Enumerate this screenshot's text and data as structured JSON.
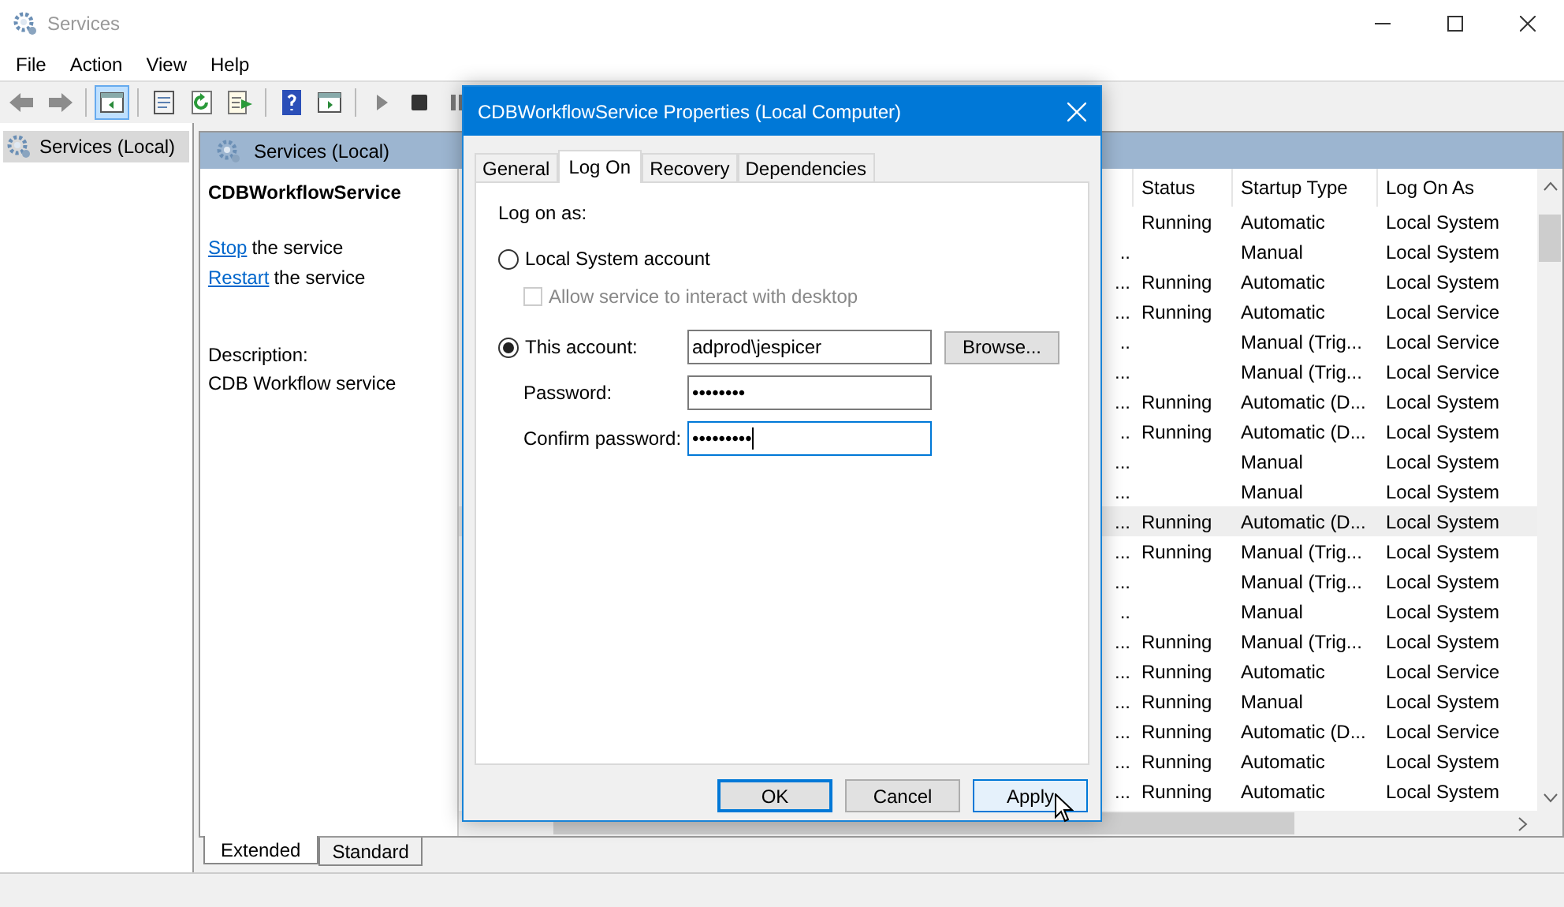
{
  "window": {
    "title": "Services"
  },
  "menu": [
    "File",
    "Action",
    "View",
    "Help"
  ],
  "toolbar": [
    [
      {
        "kind": "back",
        "pressed": false
      },
      {
        "kind": "forward",
        "pressed": false
      }
    ],
    [
      {
        "kind": "tree",
        "pressed": true
      }
    ],
    [
      {
        "kind": "properties",
        "pressed": false
      },
      {
        "kind": "refresh",
        "pressed": false
      },
      {
        "kind": "export",
        "pressed": false
      }
    ],
    [
      {
        "kind": "help",
        "pressed": false
      },
      {
        "kind": "panel",
        "pressed": false
      }
    ],
    [
      {
        "kind": "play",
        "pressed": false
      },
      {
        "kind": "stop",
        "pressed": false
      },
      {
        "kind": "pause",
        "pressed": false
      }
    ]
  ],
  "tree": {
    "items": [
      {
        "label": "Services (Local)",
        "selected": true
      }
    ]
  },
  "pane": {
    "header": "Services (Local)",
    "service_name": "CDBWorkflowService",
    "actions": [
      {
        "link": "Stop",
        "text": "the service"
      },
      {
        "link": "Restart",
        "text": "the service"
      }
    ],
    "description_label": "Description:",
    "description": "CDB Workflow service"
  },
  "table": {
    "columns": [
      "Status",
      "Startup Type",
      "Log On As"
    ],
    "rows": [
      {
        "column_1": "",
        "status": "Running",
        "startup": "Automatic",
        "logon": "Local System",
        "selected": false
      },
      {
        "column_1": "..",
        "startup": "Manual",
        "logon": "Local System",
        "selected": false
      },
      {
        "column_1": "...",
        "status": "Running",
        "startup": "Automatic",
        "logon": "Local System",
        "selected": false
      },
      {
        "column_1": "...",
        "status": "Running",
        "startup": "Automatic",
        "logon": "Local Service",
        "selected": false
      },
      {
        "column_1": "..",
        "startup": "Manual (Trig...",
        "logon": "Local Service",
        "selected": false
      },
      {
        "column_1": "...",
        "startup": "Manual (Trig...",
        "logon": "Local Service",
        "selected": false
      },
      {
        "column_1": "...",
        "status": "Running",
        "startup": "Automatic (D...",
        "logon": "Local System",
        "selected": false
      },
      {
        "column_1": "..",
        "status": "Running",
        "startup": "Automatic (D...",
        "logon": "Local System",
        "selected": false
      },
      {
        "column_1": "...",
        "startup": "Manual",
        "logon": "Local System",
        "selected": false
      },
      {
        "column_1": "...",
        "startup": "Manual",
        "logon": "Local System",
        "selected": false
      },
      {
        "column_1": "...",
        "status": "Running",
        "startup": "Automatic (D...",
        "logon": "Local System",
        "selected": true
      },
      {
        "column_1": "...",
        "status": "Running",
        "startup": "Manual (Trig...",
        "logon": "Local System",
        "selected": false
      },
      {
        "column_1": "...",
        "startup": "Manual (Trig...",
        "logon": "Local System",
        "selected": false
      },
      {
        "column_1": "..",
        "startup": "Manual",
        "logon": "Local System",
        "selected": false
      },
      {
        "column_1": "...",
        "status": "Running",
        "startup": "Manual (Trig...",
        "logon": "Local System",
        "selected": false
      },
      {
        "column_1": "...",
        "status": "Running",
        "startup": "Automatic",
        "logon": "Local Service",
        "selected": false
      },
      {
        "column_1": "...",
        "status": "Running",
        "startup": "Manual",
        "logon": "Local System",
        "selected": false
      },
      {
        "column_1": "...",
        "status": "Running",
        "startup": "Automatic (D...",
        "logon": "Local Service",
        "selected": false
      },
      {
        "column_1": "...",
        "status": "Running",
        "startup": "Automatic",
        "logon": "Local System",
        "selected": false
      },
      {
        "column_1": "...",
        "status": "Running",
        "startup": "Automatic",
        "logon": "Local System",
        "selected": false
      }
    ]
  },
  "view_tabs": [
    {
      "label": "Extended",
      "selected": true
    },
    {
      "label": "Standard",
      "selected": false
    }
  ],
  "dialog": {
    "title": "CDBWorkflowService Properties (Local Computer)",
    "tabs": [
      {
        "label": "General",
        "selected": false
      },
      {
        "label": "Log On",
        "selected": true
      },
      {
        "label": "Recovery",
        "selected": false
      },
      {
        "label": "Dependencies",
        "selected": false
      }
    ],
    "log_on_as": "Log on as:",
    "local_system": {
      "label": "Local System account",
      "selected": false
    },
    "interact": {
      "label": "Allow service to interact with desktop",
      "checked": false,
      "disabled": true
    },
    "this_account": {
      "label": "This account:",
      "selected": true,
      "value": "adprod\\jespicer"
    },
    "browse": "Browse...",
    "password": {
      "label": "Password:",
      "value": "••••••••"
    },
    "confirm": {
      "label": "Confirm password:",
      "value": "•••••••••",
      "focused": true
    },
    "buttons": [
      {
        "label": "OK",
        "default": true,
        "hovered": false
      },
      {
        "label": "Cancel",
        "default": false,
        "hovered": false
      },
      {
        "label": "Apply",
        "default": false,
        "hovered": true
      }
    ]
  }
}
